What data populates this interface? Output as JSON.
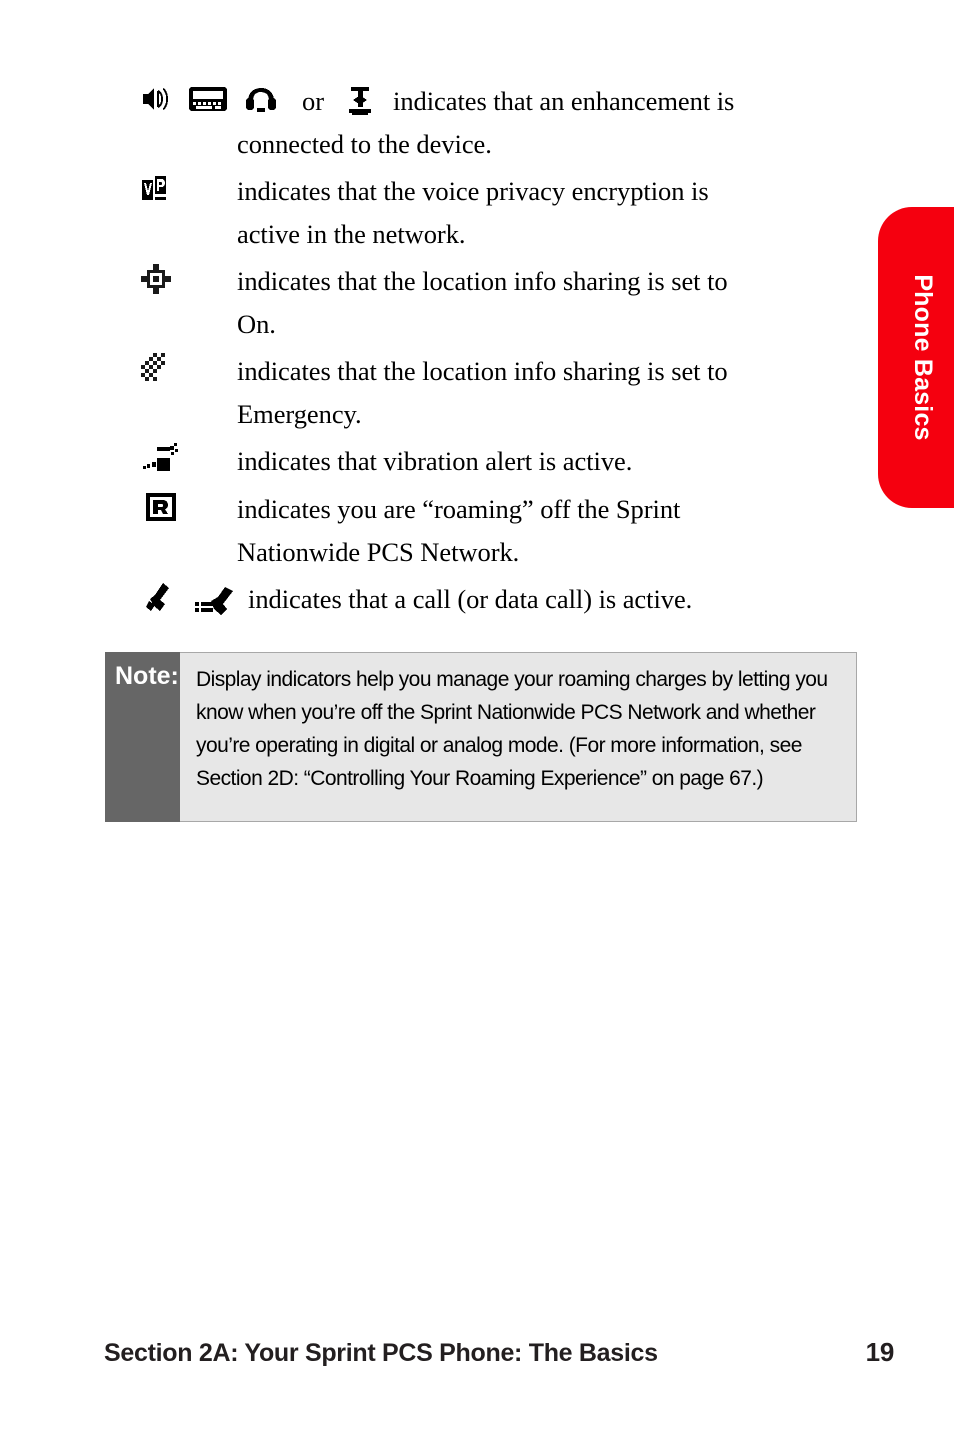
{
  "page": {
    "side_tab_label": "Phone Basics",
    "accent_color": "#f5000f",
    "note_label_bg": "#666666",
    "note_body_bg": "#e7e7e7"
  },
  "indicators": [
    {
      "icons": [
        "speaker-icon",
        "tty-device-icon",
        "headset-icon",
        "bluetooth-icon"
      ],
      "separator": "or",
      "text_line1": "indicates that an enhancement is",
      "text_line2": "connected to the device."
    },
    {
      "icons": [
        "voice-privacy-icon"
      ],
      "text_line1": "indicates that the voice privacy encryption is",
      "text_line2": "active in the network."
    },
    {
      "icons": [
        "location-on-icon"
      ],
      "text_line1": "indicates that the location info sharing is set to",
      "text_line2": "On."
    },
    {
      "icons": [
        "location-emergency-icon"
      ],
      "text_line1": "indicates that the location info sharing is set to",
      "text_line2": "Emergency."
    },
    {
      "icons": [
        "vibration-alert-icon"
      ],
      "text_line1": "indicates that vibration alert is active.",
      "text_line2": ""
    },
    {
      "icons": [
        "roaming-icon"
      ],
      "text_line1": "indicates you are “roaming” off the Sprint",
      "text_line2": "Nationwide PCS Network."
    },
    {
      "icons": [
        "voice-call-icon",
        "data-call-icon"
      ],
      "text_line1": "indicates that a call (or data call) is active.",
      "text_line2": ""
    }
  ],
  "note": {
    "label": "Note:",
    "body": "Display indicators help you manage your roaming charges by letting you know when you’re off the Sprint Nationwide PCS Network and whether you’re operating in digital or analog mode. (For more information, see Section 2D: “Controlling Your Roaming Experience” on page 67.)"
  },
  "footer": {
    "section": "Section 2A: Your Sprint PCS Phone: The Basics",
    "page_number": "19"
  }
}
